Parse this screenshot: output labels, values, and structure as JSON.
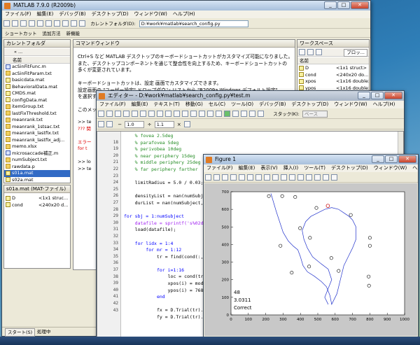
{
  "matlab": {
    "title": "MATLAB 7.9.0 (R2009b)",
    "menu": [
      "ファイル(F)",
      "編集(E)",
      "デバッグ(B)",
      "デスクトップ(D)",
      "ウィンドウ(W)",
      "ヘルプ(H)"
    ],
    "current_folder_label": "カレントフォルダ(D):",
    "current_folder_value": "D:¥work¥matlab¥search_config.py",
    "shortcuts": [
      "ショートカット",
      "追加方法",
      "新機能"
    ],
    "current_folder_pane": "カレントフォルダ",
    "folder_nav": "« ...",
    "name_col": "名前",
    "files": [
      "acSinFitFunc.m",
      "acSinFitParam.txt",
      "basicdata.mat",
      "BehavioralData.mat",
      "CMDS.mat",
      "configData.mat",
      "itemGroup.txt",
      "lastFixThreshold.txt",
      "meanrank.txt",
      "meanrank_1stsac.txt",
      "meanrank_lastfix.txt",
      "meanrank_lastfix_adj...",
      "memo.xlsx",
      "microsaccade補正.m",
      "numSubject.txt",
      "rawdata.p",
      "s01a.mat",
      "s02a.mat"
    ],
    "selected_file": "s01a.mat",
    "detail_title": "s01a.mat (MAT-ファイル)",
    "detail_rows": [
      {
        "name": "D",
        "value": "<1x1 struc..."
      },
      {
        "name": "cond",
        "value": "<240x20 d..."
      }
    ],
    "command_window": "コマンドウィンドウ",
    "cmd_lines": [
      "Ctrl+S など MATLAB デスクトップのキーボードショートカットがカスタマイズ可能になりました。",
      "また、デスクトップコンポーネントを通じて整合性を向上するため、キーボードショートカットの",
      "多くが変更されています。",
      "",
      "キーボードショートカットは、設定 画面でカスタマイズできます。",
      "設定画面の \"ユーザー設定\" ドロップダウン リストから \"R2009a Windows デフォルト設定\"",
      "を選択すると、以前のショートカットを使用できます。",
      "",
      "このメッセージを再度表示しない"
    ],
    "cmd_bits": [
      ">> te",
      "??? 関",
      "",
      "エラー",
      "for t",
      "",
      ">> lo",
      ">> te"
    ],
    "workspace_title": "ワークスペース",
    "workspace_name_col": "名前",
    "workspace_vars": [
      {
        "name": "D",
        "value": "<1x1 struct>"
      },
      {
        "name": "cond",
        "value": "<240x20 do..."
      },
      {
        "name": "xpos",
        "value": "<1x16 double>"
      },
      {
        "name": "ypos",
        "value": "<1x16 double>"
      }
    ],
    "workspace_view": "プロッ...",
    "start_button": "スタート(S)",
    "status": "処理中"
  },
  "editor": {
    "title": "エディター - D:¥work¥matlab¥search_config.py¥test.m",
    "menu": [
      "ファイル(F)",
      "編集(E)",
      "テキスト(T)",
      "移動(G)",
      "セル(C)",
      "ツール(O)",
      "デバッグ(B)",
      "デスクトップ(D)",
      "ウィンドウ(W)",
      "ヘルプ(H)"
    ],
    "stack_label": "スタック(K):",
    "stack_value": "ベース",
    "cell_val1": "1.0",
    "cell_op": "÷",
    "cell_val2": "1.1",
    "cell_val3": "×",
    "line_numbers": [
      "18",
      "19",
      "20",
      "21",
      "22",
      "23",
      "24",
      "25",
      "26",
      "27",
      "28",
      "29",
      "30",
      "31",
      "32",
      "33",
      "34",
      "35",
      "36",
      "37",
      "38",
      "39",
      "40",
      "41",
      "42",
      "43"
    ],
    "lines": [
      {
        "t": "    % fovea 2.5deg",
        "c": "cm"
      },
      {
        "t": "    % parafovea 5deg",
        "c": "cm"
      },
      {
        "t": "    % perivobea 10deg",
        "c": "cm"
      },
      {
        "t": "    % near periphery 15deg",
        "c": "cm"
      },
      {
        "t": "    % middle periphery 25deg",
        "c": "cm"
      },
      {
        "t": "    % far periphery farther",
        "c": "cm"
      },
      {
        "t": "",
        "c": ""
      },
      {
        "t": "    limitRadius = 5.0 / 0.03;",
        "c": ""
      },
      {
        "t": "",
        "c": ""
      },
      {
        "t": "    densityList = nan(numSubject,4,1",
        "c": ""
      },
      {
        "t": "    durList = nan(numSubject,4,12,20",
        "c": ""
      },
      {
        "t": "",
        "c": ""
      },
      {
        "t": "for sbj = 1:numSubject",
        "c": "kw"
      },
      {
        "t": "    datafile = sprintf('s%02da.m",
        "c": "st"
      },
      {
        "t": "    load(datafile);",
        "c": ""
      },
      {
        "t": "",
        "c": ""
      },
      {
        "t": "    for lidx = 1:4",
        "c": "kw"
      },
      {
        "t": "        for mr = 1:12",
        "c": "kw"
      },
      {
        "t": "            tr = find(cond(:,1)==",
        "c": ""
      },
      {
        "t": "",
        "c": ""
      },
      {
        "t": "            for i=1:16",
        "c": "kw"
      },
      {
        "t": "                loc = cond(tr,i+",
        "c": ""
      },
      {
        "t": "                xpos(i) = mod(lo",
        "c": ""
      },
      {
        "t": "                ypos(i) = 768-((",
        "c": ""
      },
      {
        "t": "            end",
        "c": "kw"
      },
      {
        "t": "",
        "c": ""
      },
      {
        "t": "            fx = D.Trial(tr).L.H",
        "c": ""
      },
      {
        "t": "            fy = D.Trial(tr).L.V",
        "c": ""
      }
    ]
  },
  "figure": {
    "title": "Figure 1",
    "menu": [
      "ファイル(F)",
      "編集(E)",
      "表示(V)",
      "挿入(I)",
      "ツール(T)",
      "デスクトップ(D)",
      "ウィンドウ(W)",
      "ヘルプ(H)"
    ],
    "labels": [
      "48",
      "3.0311",
      "Correct"
    ]
  },
  "chart_data": {
    "type": "scatter",
    "xlim": [
      0,
      1000
    ],
    "ylim": [
      0,
      700
    ],
    "xticks": [
      0,
      100,
      200,
      300,
      400,
      500,
      600,
      700,
      800,
      900,
      1000
    ],
    "yticks": [
      0,
      100,
      200,
      300,
      400,
      500,
      600,
      700
    ],
    "grid": false,
    "markers": [
      [
        218,
        675
      ],
      [
        295,
        675
      ],
      [
        370,
        670
      ],
      [
        492,
        608
      ],
      [
        690,
        568
      ],
      [
        398,
        493
      ],
      [
        455,
        438
      ],
      [
        800,
        438
      ],
      [
        285,
        393
      ],
      [
        800,
        393
      ],
      [
        578,
        323
      ],
      [
        350,
        240
      ],
      [
        450,
        275
      ],
      [
        620,
        250
      ],
      [
        793,
        218
      ],
      [
        795,
        166
      ]
    ],
    "target_marker": [
      558,
      620
    ],
    "trace": [
      [
        230,
        690
      ],
      [
        260,
        590
      ],
      [
        280,
        530
      ],
      [
        300,
        470
      ],
      [
        330,
        420
      ],
      [
        360,
        390
      ],
      [
        385,
        370
      ],
      [
        400,
        330
      ],
      [
        415,
        280
      ],
      [
        440,
        245
      ],
      [
        480,
        220
      ],
      [
        520,
        190
      ],
      [
        550,
        160
      ],
      [
        570,
        110
      ],
      [
        580,
        60
      ],
      [
        610,
        120
      ],
      [
        630,
        200
      ],
      [
        650,
        280
      ],
      [
        680,
        340
      ],
      [
        700,
        380
      ],
      [
        720,
        430
      ],
      [
        720,
        500
      ],
      [
        700,
        540
      ],
      [
        680,
        560
      ],
      [
        650,
        580
      ],
      [
        620,
        600
      ],
      [
        580,
        610
      ],
      [
        540,
        600
      ],
      [
        500,
        580
      ],
      [
        460,
        560
      ],
      [
        430,
        530
      ],
      [
        410,
        480
      ],
      [
        420,
        430
      ],
      [
        440,
        380
      ],
      [
        470,
        330
      ],
      [
        520,
        290
      ],
      [
        560,
        260
      ],
      [
        580,
        200
      ],
      [
        560,
        150
      ],
      [
        540,
        100
      ],
      [
        560,
        60
      ]
    ],
    "trace_color": "#2233cc",
    "marker_color": "#000000"
  },
  "colors": {
    "titlebar_active": "#a7bfdc",
    "selection": "#316ac5",
    "comment": "#228b22",
    "keyword": "#0000ff",
    "string": "#a020f0"
  }
}
